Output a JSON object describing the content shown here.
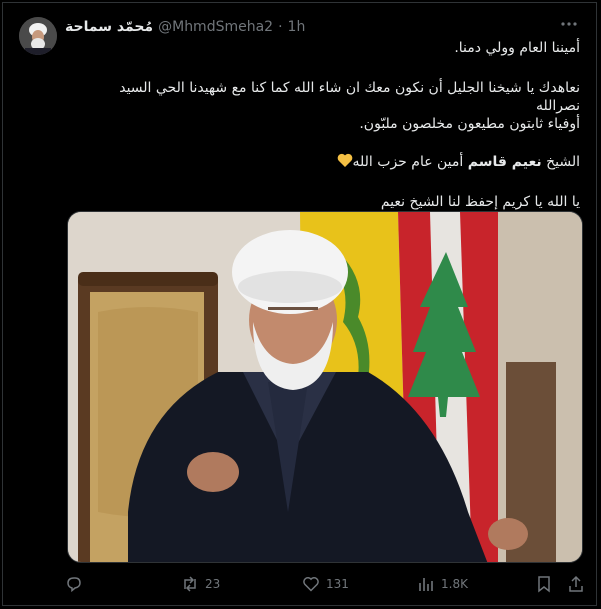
{
  "post": {
    "display_name": "مُحمّد سماحة",
    "handle": "@MhmdSmeha2",
    "separator": "·",
    "time": "1h",
    "more_icon": "more-horizontal-icon",
    "lines": [
      "أميننا العام وولي دمنا.",
      "نعاهدك يا شيخنا الجليل أن نكون معك ان شاء الله كما كنا مع شهيدنا الحي السيد نصرالله",
      "أوفياء ثابتون مطيعون مخلصون ملبّون.",
      "يا الله يا كريم إحفظ لنا الشيخ نعيم"
    ],
    "title_line": {
      "prefix": "الشيخ ",
      "name": "نعيم قاسم",
      "suffix": " أمين عام حزب الله"
    }
  },
  "actions": {
    "reply": {
      "icon": "reply-icon",
      "count": ""
    },
    "repost": {
      "icon": "repost-icon",
      "count": "23"
    },
    "like": {
      "icon": "heart-icon",
      "count": "131"
    },
    "views": {
      "icon": "views-icon",
      "count": "1.8K"
    },
    "bookmark": {
      "icon": "bookmark-icon"
    },
    "share": {
      "icon": "share-icon"
    }
  },
  "colors": {
    "background": "#000000",
    "text": "#e7e9ea",
    "secondary": "#71767b",
    "border": "#2f3336",
    "heart_emoji": "#f5c044"
  }
}
